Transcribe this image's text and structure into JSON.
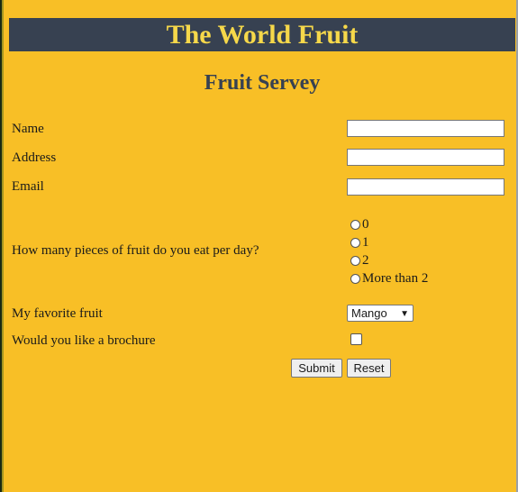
{
  "header": {
    "title": "The World Fruit"
  },
  "form": {
    "title": "Fruit Servey",
    "name_label": "Name",
    "address_label": "Address",
    "email_label": "Email",
    "name_value": "",
    "address_value": "",
    "email_value": "",
    "fruit_count_question": "How many pieces of fruit do you eat per day?",
    "fruit_count_options": [
      "0",
      "1",
      "2",
      "More than 2"
    ],
    "favorite_label": "My favorite fruit",
    "favorite_selected": "Mango",
    "brochure_label": "Would you like a brochure",
    "brochure_checked": false,
    "submit_label": "Submit",
    "reset_label": "Reset"
  },
  "icons": {
    "select_arrow": "chevron-down-icon"
  },
  "colors": {
    "background": "#f8bf26",
    "banner": "#374151",
    "banner_text": "#f6d84a"
  }
}
